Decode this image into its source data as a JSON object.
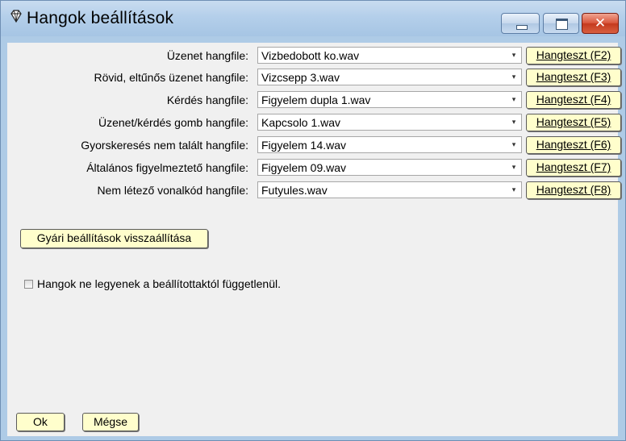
{
  "window": {
    "title": "Hangok beállítások",
    "close_glyph": "✕"
  },
  "rows": [
    {
      "label": "Üzenet hangfile:",
      "value": "Vizbedobott ko.wav",
      "test": "Hangteszt (F2)"
    },
    {
      "label": "Rövid, eltűnős üzenet hangfile:",
      "value": "Vizcsepp 3.wav",
      "test": "Hangteszt (F3)"
    },
    {
      "label": "Kérdés hangfile:",
      "value": "Figyelem dupla 1.wav",
      "test": "Hangteszt (F4)"
    },
    {
      "label": "Üzenet/kérdés gomb hangfile:",
      "value": "Kapcsolo 1.wav",
      "test": "Hangteszt (F5)"
    },
    {
      "label": "Gyorskeresés nem talált hangfile:",
      "value": "Figyelem 14.wav",
      "test": "Hangteszt (F6)"
    },
    {
      "label": "Általános figyelmeztető hangfile:",
      "value": "Figyelem 09.wav",
      "test": "Hangteszt (F7)"
    },
    {
      "label": "Nem létező vonalkód hangfile:",
      "value": "Futyules.wav",
      "test": "Hangteszt (F8)"
    }
  ],
  "factory_reset_label": "Gyári beállítások visszaállítása",
  "checkbox": {
    "label": "Hangok ne legyenek a beállítottaktól függetlenül.",
    "checked": false
  },
  "buttons": {
    "ok": "Ok",
    "cancel": "Mégse"
  },
  "icons": {
    "app": "gem-icon",
    "combo_arrow": "▾"
  }
}
